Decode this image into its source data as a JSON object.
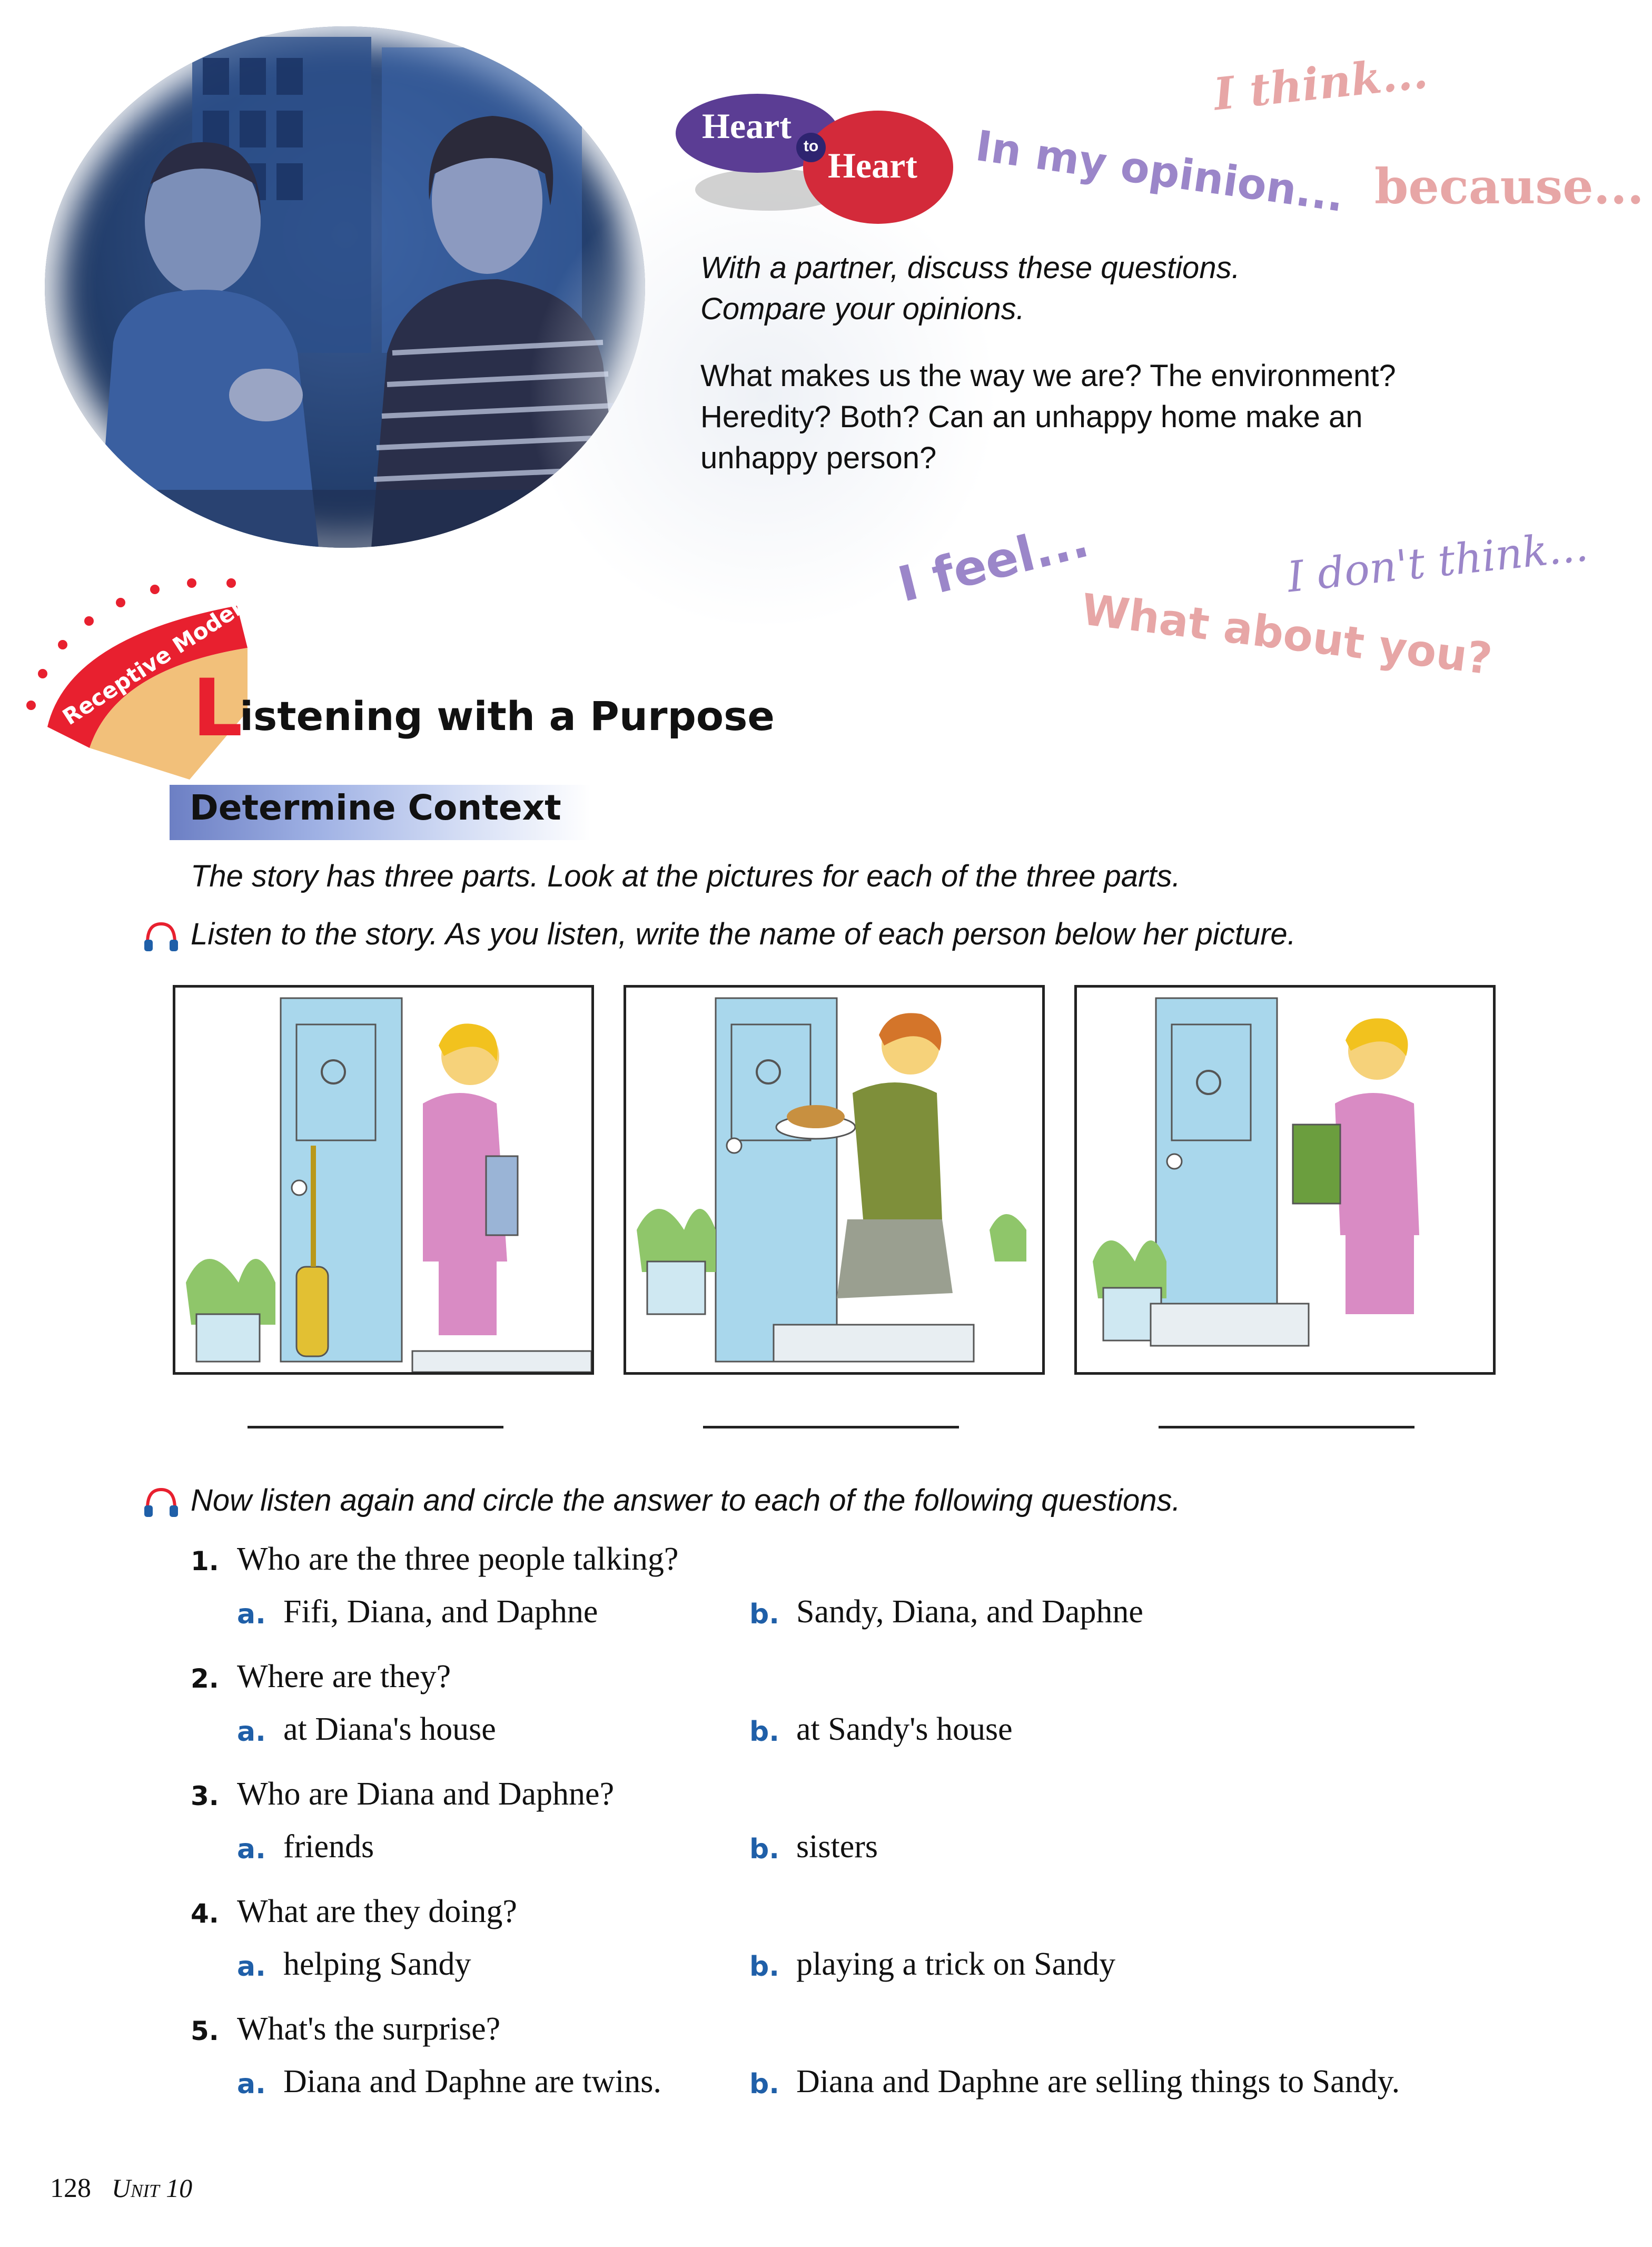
{
  "heart_to_heart": {
    "word1": "Heart",
    "connector": "to",
    "word2": "Heart",
    "phrases": [
      "In my opinion...",
      "I think...",
      "because...",
      "I feel...",
      "I don't think...",
      "What about you?"
    ],
    "instruction_line1": "With a partner, discuss these questions.",
    "instruction_line2": "Compare your opinions.",
    "question_line1": "What makes us the way we are? The environment?",
    "question_line2": "Heredity? Both? Can an unhappy home make an",
    "question_line3": "unhappy person?"
  },
  "section": {
    "badge": "Receptive Model",
    "title_initial": "L",
    "title_rest": "istening with a Purpose",
    "subtitle": "Determine Context"
  },
  "instructions": {
    "intro": "The story has three parts. Look at the pictures for each of the three parts.",
    "listen1": "Listen to the story. As you listen, write the name of each person below her picture.",
    "listen2": "Now listen again and circle the answer to each of the following questions."
  },
  "pictures": [
    {
      "scene": "woman with vacuum cleaner at door"
    },
    {
      "scene": "woman with plate of cookies at door"
    },
    {
      "scene": "woman with bag of groceries at door"
    }
  ],
  "questions": [
    {
      "num": "1.",
      "text": "Who are the three people talking?",
      "a": "Fifi, Diana, and Daphne",
      "b": "Sandy, Diana, and Daphne"
    },
    {
      "num": "2.",
      "text": "Where are they?",
      "a": "at Diana's house",
      "b": "at Sandy's house"
    },
    {
      "num": "3.",
      "text": "Who are Diana and Daphne?",
      "a": "friends",
      "b": "sisters"
    },
    {
      "num": "4.",
      "text": "What are they doing?",
      "a": "helping Sandy",
      "b": "playing a trick on Sandy"
    },
    {
      "num": "5.",
      "text": "What's the surprise?",
      "a": "Diana and Daphne are twins.",
      "b": "Diana and Daphne are selling things to Sandy."
    }
  ],
  "option_letters": {
    "a": "a.",
    "b": "b."
  },
  "footer": {
    "page": "128",
    "unit": "Unit 10"
  },
  "colors": {
    "accent_red": "#e8202f",
    "accent_blue": "#1f5fa8",
    "heart_purple": "#5b3d94",
    "heart_red": "#d32a3a",
    "phrase_purple": "#9b86c9",
    "phrase_pink": "#e7a6a6"
  },
  "icons": [
    "headphones-icon"
  ]
}
